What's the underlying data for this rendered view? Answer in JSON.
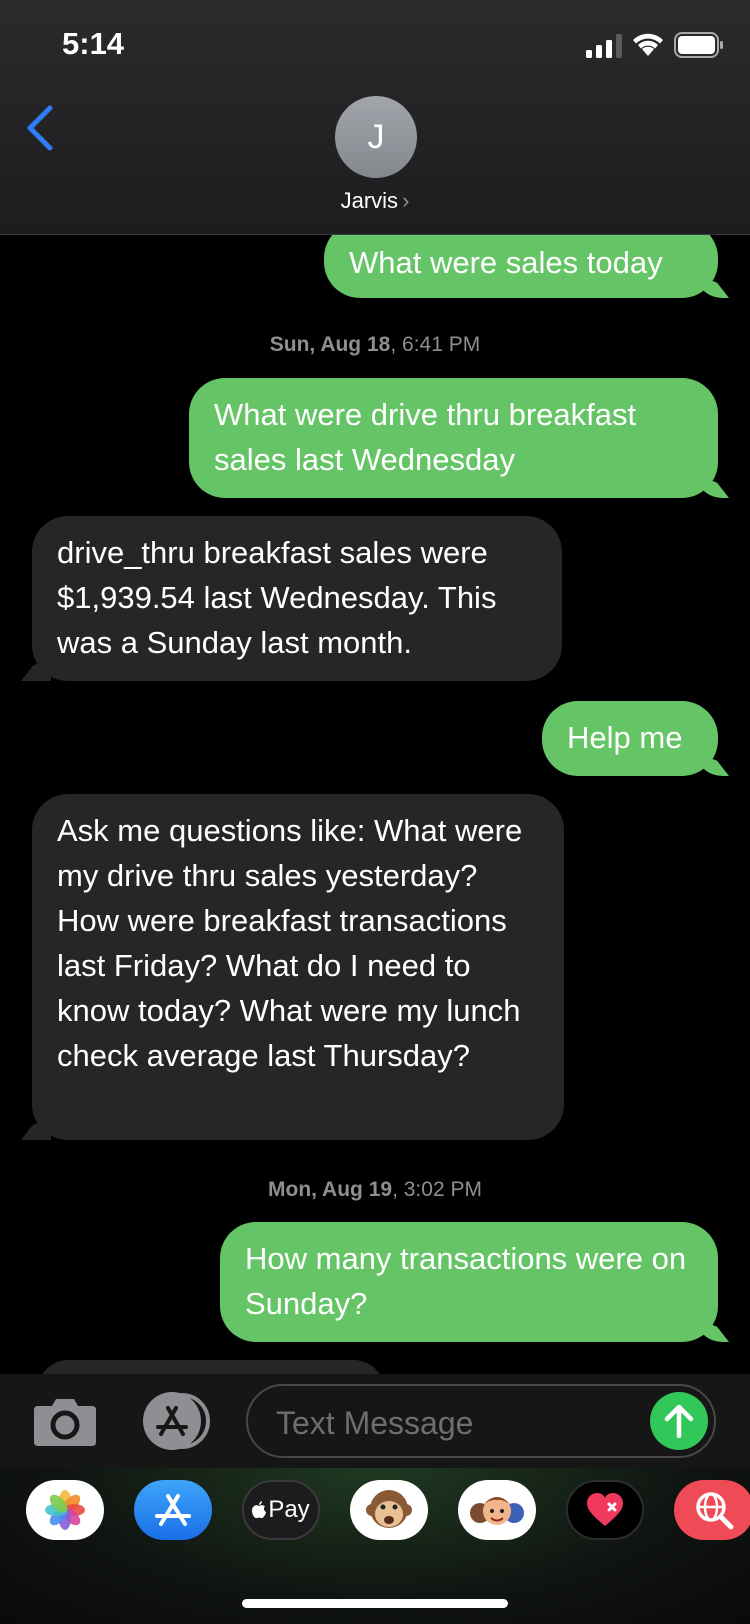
{
  "status_bar": {
    "time": "5:14"
  },
  "header": {
    "avatar_initial": "J",
    "contact_name": "Jarvis",
    "contact_chevron": "›",
    "back_icon": "chevron-left-icon"
  },
  "messages": [
    {
      "from": "me",
      "text": "What were sales today"
    },
    {
      "type": "stamp",
      "day": "Sun, Aug 18",
      "time": ", 6:41 PM"
    },
    {
      "from": "me",
      "text": "What were drive thru breakfast sales last Wednesday"
    },
    {
      "from": "contact",
      "text": "drive_thru breakfast sales were $1,939.54 last Wednesday. This was a Sunday last month."
    },
    {
      "from": "me",
      "text": "Help me"
    },
    {
      "from": "contact",
      "text": "Ask me questions like: What were my drive thru sales yesterday? How were breakfast transactions last Friday? What do I need to know today? What were my lunch check average last Thursday?"
    },
    {
      "type": "stamp",
      "day": "Mon, Aug 19",
      "time": ", 3:02 PM"
    },
    {
      "from": "me",
      "text": "How many transactions were on Sunday?"
    }
  ],
  "compose": {
    "placeholder": "Text Message",
    "camera_icon": "camera-icon",
    "apps_icon": "app-store-icon",
    "send_icon": "arrow-up-icon"
  },
  "app_drawer": [
    {
      "name": "photos",
      "icon": "photos-icon"
    },
    {
      "name": "app-store",
      "icon": "app-store-icon"
    },
    {
      "name": "apple-pay",
      "label": "Pay",
      "icon": "apple-pay-icon"
    },
    {
      "name": "animoji",
      "icon": "monkey-icon"
    },
    {
      "name": "memoji",
      "icon": "memoji-icon"
    },
    {
      "name": "digital-touch",
      "icon": "heart-icon"
    },
    {
      "name": "images-search",
      "icon": "globe-search-icon"
    }
  ],
  "colors": {
    "outgoing_bubble": "#65c466",
    "incoming_bubble": "#262628",
    "accent": "#2f7cf6",
    "send_button": "#32c759"
  }
}
